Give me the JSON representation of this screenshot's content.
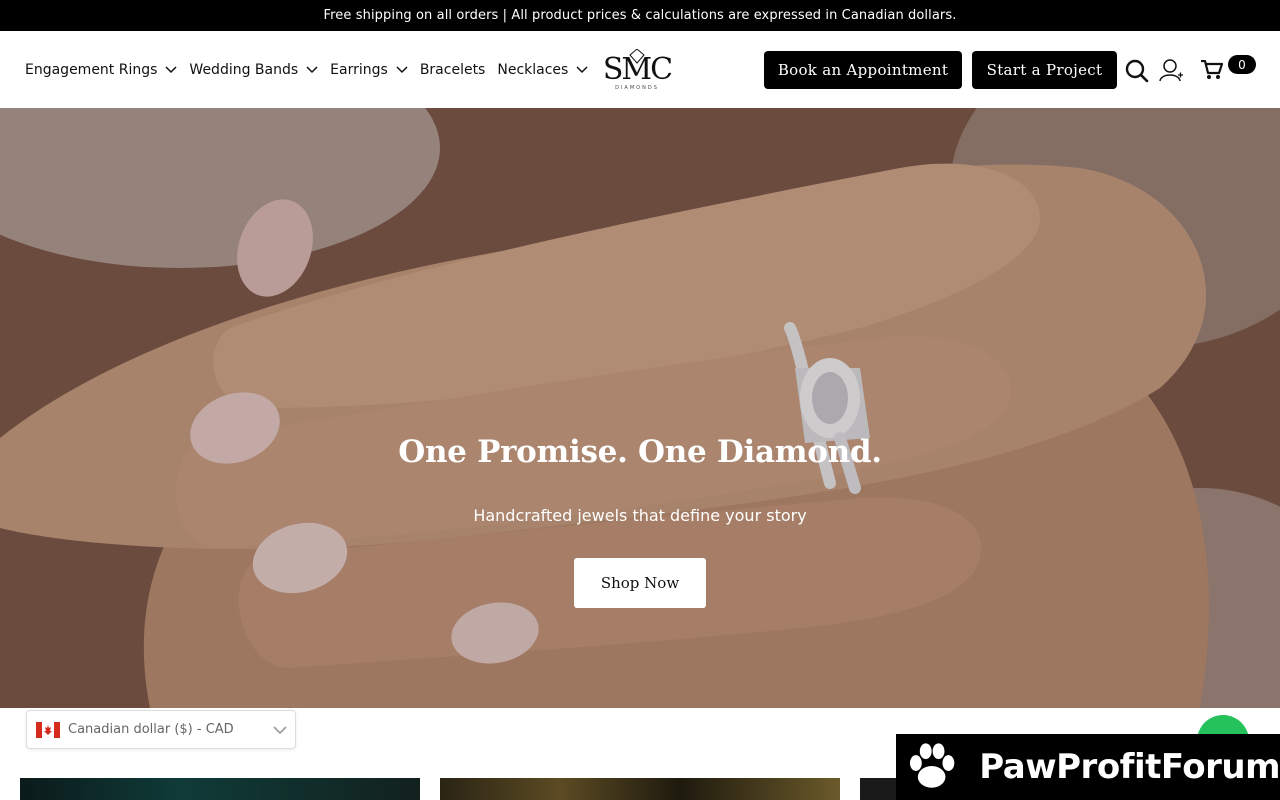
{
  "announcement": "Free shipping on all orders | All product prices & calculations are expressed in Canadian dollars.",
  "nav": {
    "items": [
      {
        "label": "Engagement Rings",
        "has_dropdown": true
      },
      {
        "label": "Wedding Bands",
        "has_dropdown": true
      },
      {
        "label": "Earrings",
        "has_dropdown": true
      },
      {
        "label": "Bracelets",
        "has_dropdown": false
      },
      {
        "label": "Necklaces",
        "has_dropdown": true
      }
    ]
  },
  "logo": {
    "mark": "SMC",
    "sub": "DIAMONDS"
  },
  "header_buttons": {
    "appointment": "Book an Appointment",
    "project": "Start a Project"
  },
  "header_icons": [
    "search-icon",
    "account-icon",
    "cart-icon"
  ],
  "cart": {
    "count": "0"
  },
  "hero": {
    "title": "One Promise. One Diamond.",
    "subtitle": "Handcrafted jewels that define your story",
    "cta": "Shop Now"
  },
  "currency_selector": {
    "value": "Canadian dollar ($) - CAD",
    "flag": "canada-flag-icon"
  },
  "chat": {
    "icon": "whatsapp-icon"
  },
  "watermark": {
    "text": "PawProfitForum",
    "icon": "paw-icon"
  },
  "colors": {
    "announce_bg": "#000000",
    "button_dark": "#000000",
    "chat": "#25c15b"
  }
}
